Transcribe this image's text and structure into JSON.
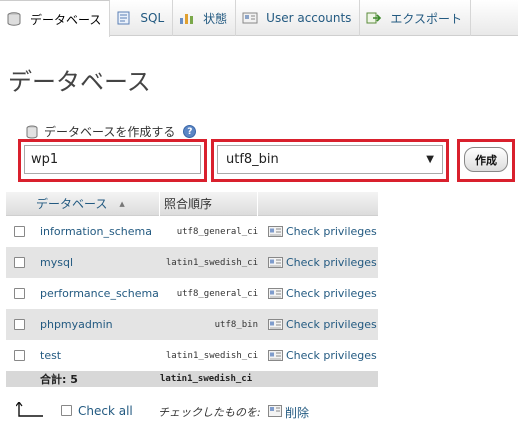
{
  "tabs": [
    {
      "label": "データベース",
      "icon": "database-icon",
      "active": true
    },
    {
      "label": "SQL",
      "icon": "sql-icon",
      "active": false
    },
    {
      "label": "状態",
      "icon": "status-icon",
      "active": false
    },
    {
      "label": "User accounts",
      "icon": "users-icon",
      "active": false
    },
    {
      "label": "エクスポート",
      "icon": "export-icon",
      "active": false
    }
  ],
  "page": {
    "title": "データベース"
  },
  "create": {
    "legend": "データベースを作成する",
    "help_glyph": "?",
    "name_value": "wp1",
    "collation_value": "utf8_bin",
    "button_label": "作成"
  },
  "table": {
    "headers": {
      "name": "データベース",
      "collation": "照合順序"
    },
    "rows": [
      {
        "name": "information_schema",
        "collation": "utf8_general_ci",
        "privileges": "Check privileges"
      },
      {
        "name": "mysql",
        "collation": "latin1_swedish_ci",
        "privileges": "Check privileges"
      },
      {
        "name": "performance_schema",
        "collation": "utf8_general_ci",
        "privileges": "Check privileges"
      },
      {
        "name": "phpmyadmin",
        "collation": "utf8_bin",
        "privileges": "Check privileges"
      },
      {
        "name": "test",
        "collation": "latin1_swedish_ci",
        "privileges": "Check privileges"
      }
    ],
    "footer": {
      "total": "合計: 5",
      "collation": "latin1_swedish_ci"
    }
  },
  "bottom": {
    "check_all": "Check all",
    "with_selected": "チェックしたものを:",
    "delete": "削除"
  },
  "colors": {
    "frame": "#d9202d",
    "link": "#235a81"
  }
}
